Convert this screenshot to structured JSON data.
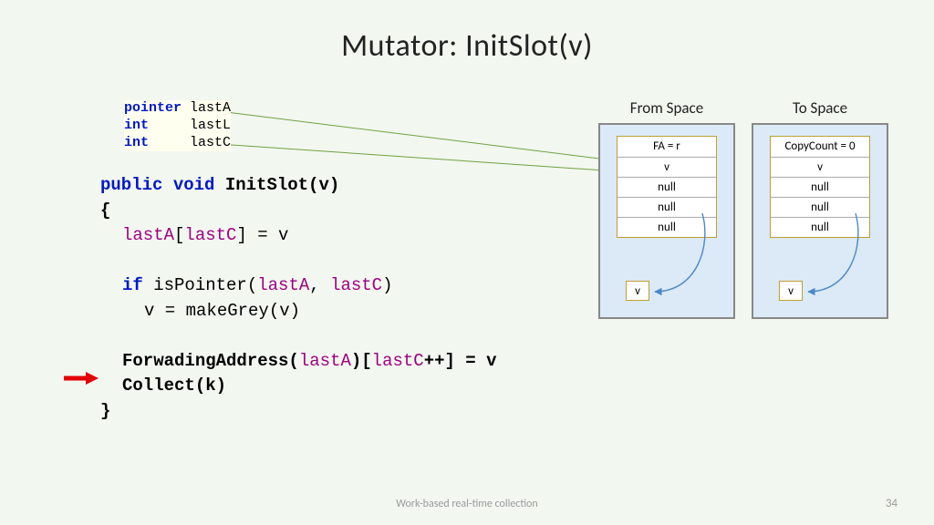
{
  "title": "Mutator: InitSlot(v)",
  "decl": {
    "line1_kw": "pointer",
    "line1_id": "lastA",
    "line2_kw": "int",
    "line2_id": "lastL",
    "line3_kw": "int",
    "line3_id": "lastC"
  },
  "code": {
    "sig_kw1": "public",
    "sig_kw2": "void",
    "sig_fn": "InitSlot(v)",
    "open": "{",
    "l1a": "lastA",
    "l1b": "[",
    "l1c": "lastC",
    "l1d": "] = v",
    "l2_kw": "if",
    "l2a": " isPointer(",
    "l2b": "lastA",
    "l2c": ", ",
    "l2d": "lastC",
    "l2e": ")",
    "l3": "v = makeGrey(v)",
    "l4a": "ForwadingAddress(",
    "l4b": "lastA",
    "l4c": ")[",
    "l4d": "lastC",
    "l4e": "++] = v",
    "l5": "Collect(k)",
    "close": "}"
  },
  "spaces": {
    "from": {
      "title": "From Space",
      "cells": [
        "FA = r",
        "v",
        "null",
        "null",
        "null"
      ],
      "bottom": "v"
    },
    "to": {
      "title": "To Space",
      "cells": [
        "CopyCount = 0",
        "v",
        "null",
        "null",
        "null"
      ],
      "bottom": "v"
    }
  },
  "footer": "Work-based real-time collection",
  "page": "34"
}
